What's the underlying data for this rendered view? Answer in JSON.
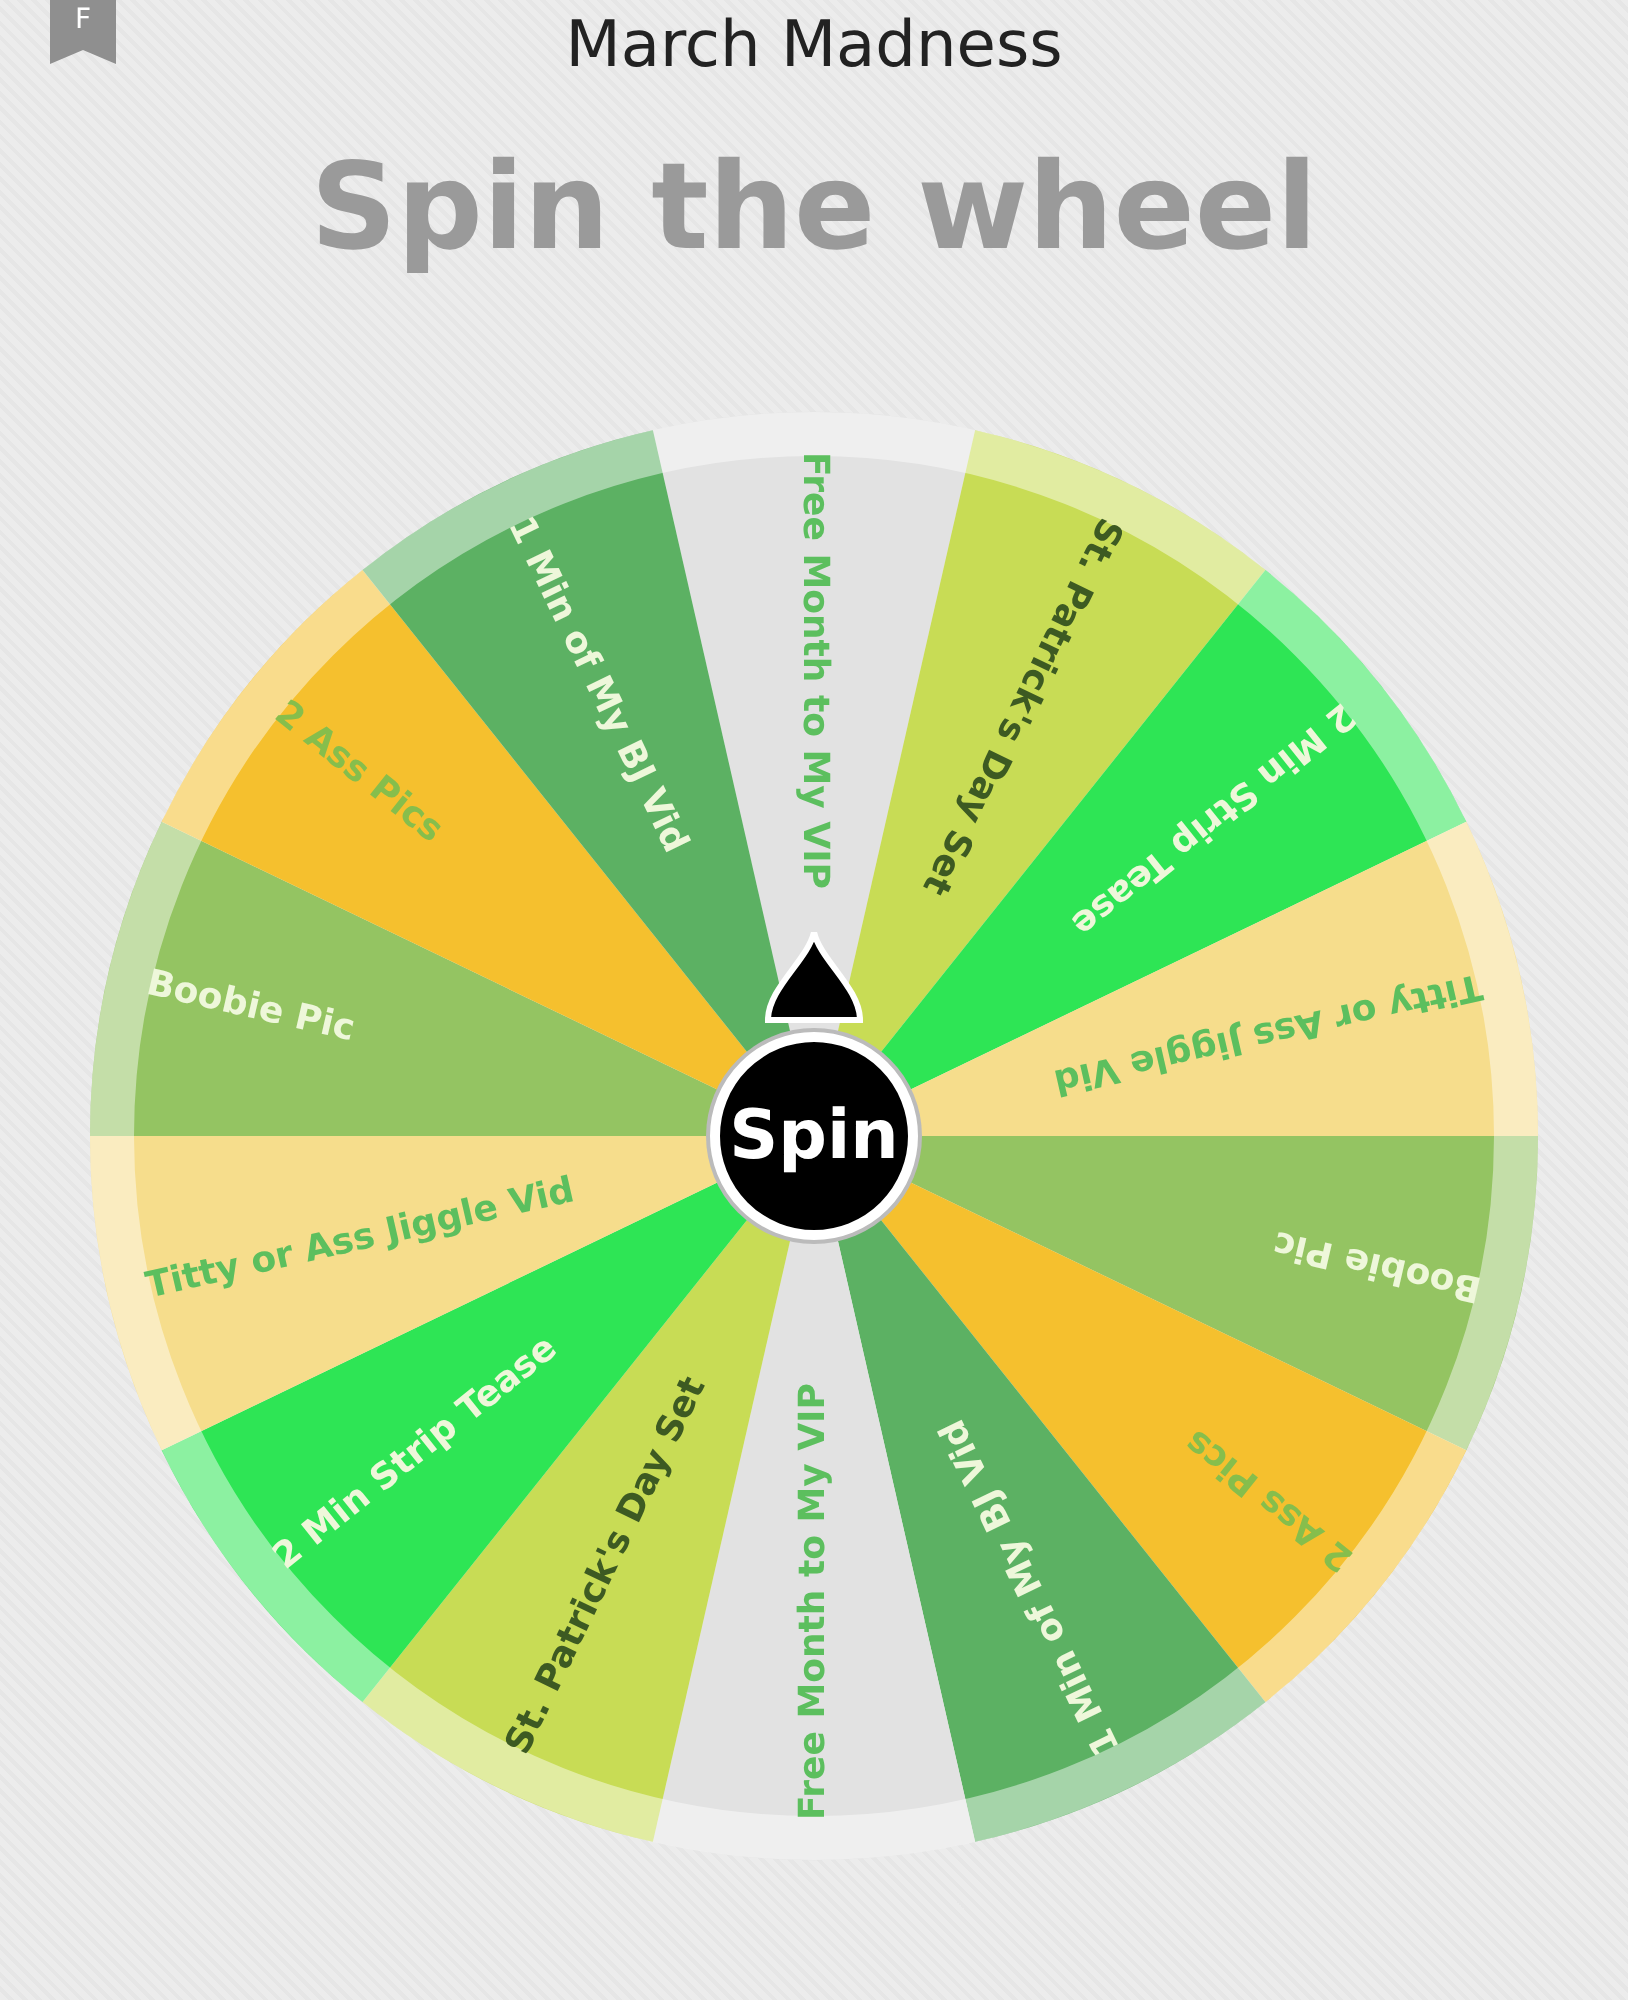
{
  "header": {
    "bookmark_letter": "F",
    "title": "March Madness"
  },
  "heading": "Spin the wheel",
  "wheel": {
    "segments": [
      {
        "label": "Free Month to My VIP",
        "color": "#e2e2e2"
      },
      {
        "label": "St. Patrick's Day Set",
        "color": "#c8dc55"
      },
      {
        "label": "2 Min Strip Tease",
        "color": "#2ee555"
      },
      {
        "label": "Titty or Ass Jiggle Vid",
        "color": "#f6dd8c"
      },
      {
        "label": "Boobie Pic",
        "color": "#94c462"
      },
      {
        "label": "2 Ass Pics",
        "color": "#f5c02e"
      },
      {
        "label": "1 Min of My BJ Vid",
        "color": "#5cb163"
      },
      {
        "label": "Free Month to My VIP",
        "color": "#e2e2e2"
      },
      {
        "label": "St. Patrick's Day Set",
        "color": "#c8dc55"
      },
      {
        "label": "2 Min Strip Tease",
        "color": "#2ee555"
      },
      {
        "label": "Titty or Ass Jiggle Vid",
        "color": "#f6dd8c"
      },
      {
        "label": "Boobie Pic",
        "color": "#94c462"
      },
      {
        "label": "2 Ass Pics",
        "color": "#f5c02e"
      },
      {
        "label": "1 Min of My BJ Vid",
        "color": "#5cb163"
      }
    ],
    "spin_button": "Spin"
  }
}
